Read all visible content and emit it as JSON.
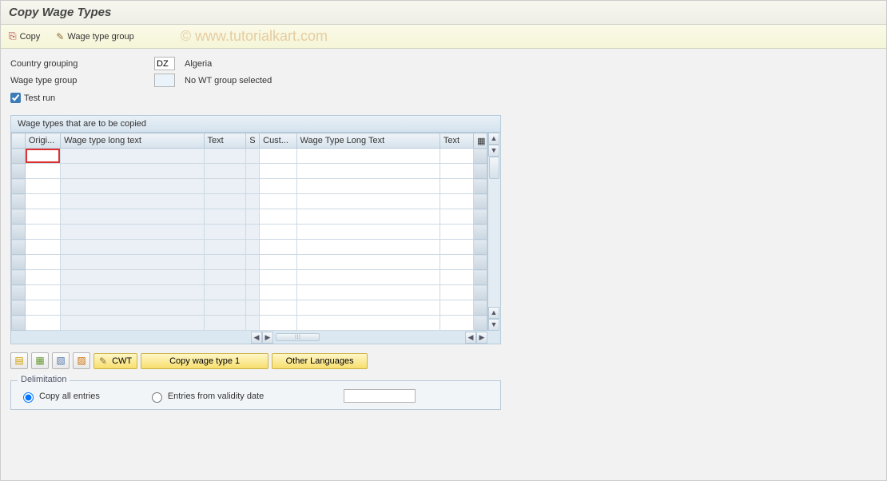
{
  "title": "Copy Wage Types",
  "toolbar": {
    "copy_label": "Copy",
    "wage_type_group_label": "Wage type group"
  },
  "watermark": "© www.tutorialkart.com",
  "form": {
    "country_label": "Country grouping",
    "country_value": "DZ",
    "country_desc": "Algeria",
    "wt_group_label": "Wage type group",
    "wt_group_value": "",
    "wt_group_desc": "No WT group selected",
    "test_run_label": "Test run"
  },
  "grid": {
    "panel_title": "Wage types that are to be copied",
    "columns": {
      "origi": "Origi...",
      "long1": "Wage type long text",
      "text1": "Text",
      "s": "S",
      "cust": "Cust...",
      "long2": "Wage Type Long Text",
      "text2": "Text"
    },
    "config_icon": "table-settings-icon"
  },
  "actions": {
    "icon1": "select-all-icon",
    "icon2": "deselect-all-icon",
    "icon3": "new-entries-icon",
    "icon4": "delete-icon",
    "cwt_label": "CWT",
    "cwt_icon": "pencil-icon",
    "copy_wt1_label": "Copy wage type 1",
    "other_lang_label": "Other Languages"
  },
  "delimitation": {
    "legend": "Delimitation",
    "opt_all": "Copy all entries",
    "opt_from": "Entries from validity date",
    "date_value": ""
  }
}
